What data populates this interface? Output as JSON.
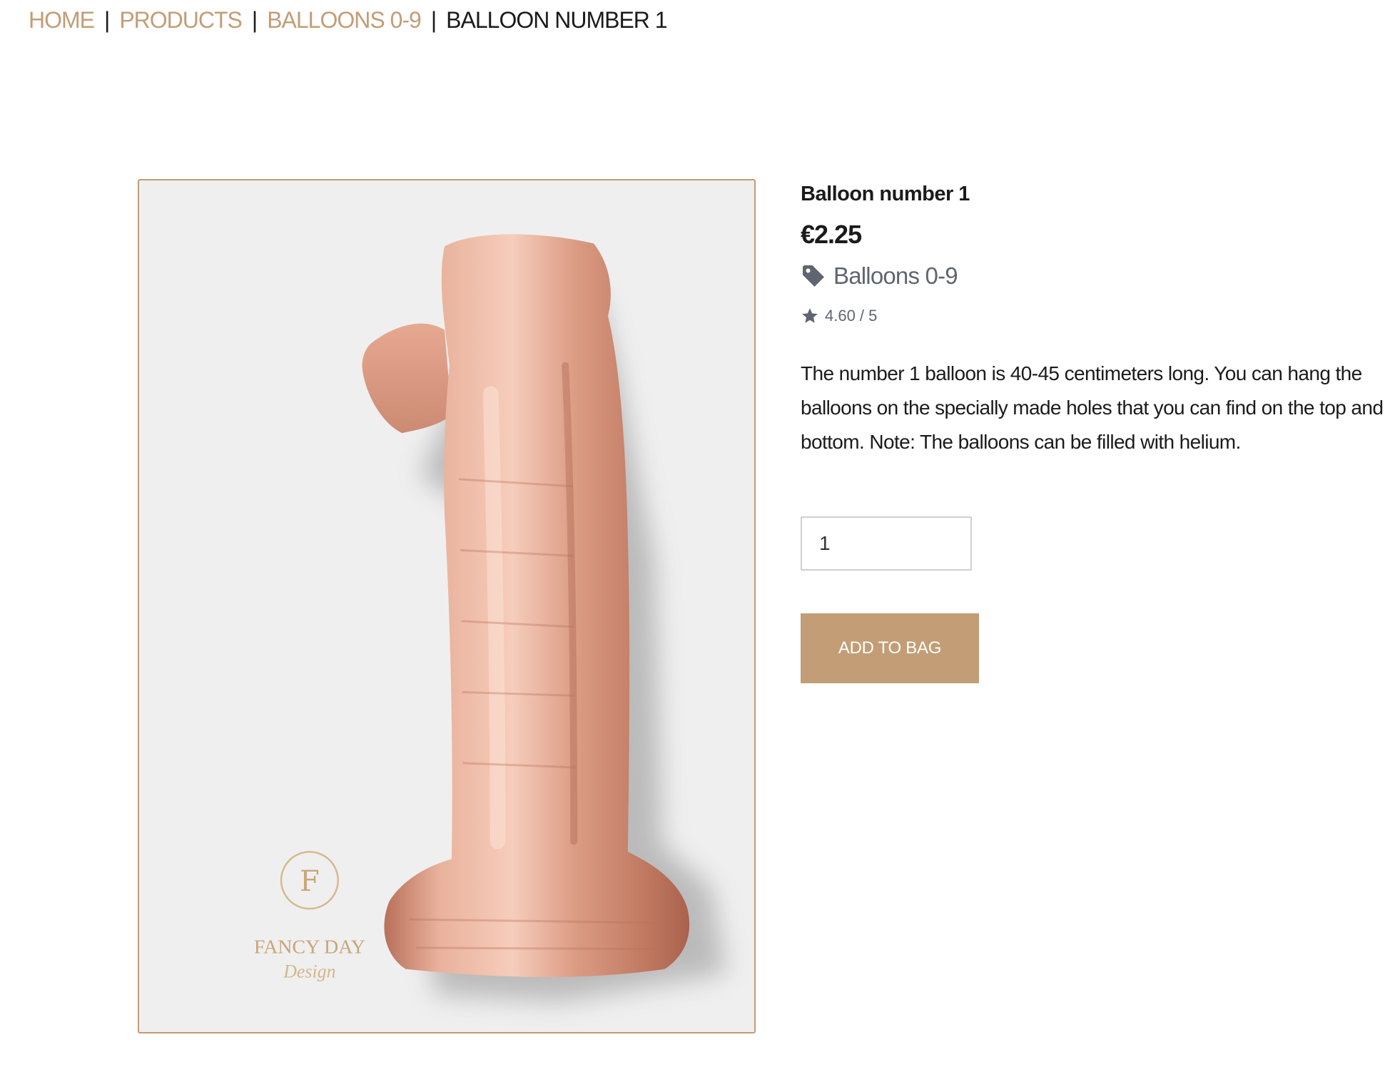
{
  "breadcrumb": {
    "items": [
      {
        "label": "HOME"
      },
      {
        "label": "PRODUCTS"
      },
      {
        "label": "BALLOONS 0-9"
      }
    ],
    "separator": "|",
    "current": "BALLOON NUMBER 1"
  },
  "product": {
    "title": "Balloon number 1",
    "price": "€2.25",
    "category": "Balloons 0-9",
    "category_icon": "tag-icon",
    "rating": "4.60 / 5",
    "rating_icon": "star-icon",
    "description": "The number 1 balloon is 40-45 centimeters long. You can hang the balloons on the specially made holes that you can find on the top and bottom. Note: The balloons can be filled with helium.",
    "image": {
      "logo_letter": "F",
      "logo_name": "FANCY DAY",
      "logo_tagline": "Design"
    }
  },
  "cart": {
    "quantity": "1",
    "add_label": "ADD TO BAG"
  },
  "colors": {
    "accent": "#c29d76",
    "text": "#1b1b1b",
    "muted": "#5e6670",
    "balloon": "#e0a48c"
  }
}
